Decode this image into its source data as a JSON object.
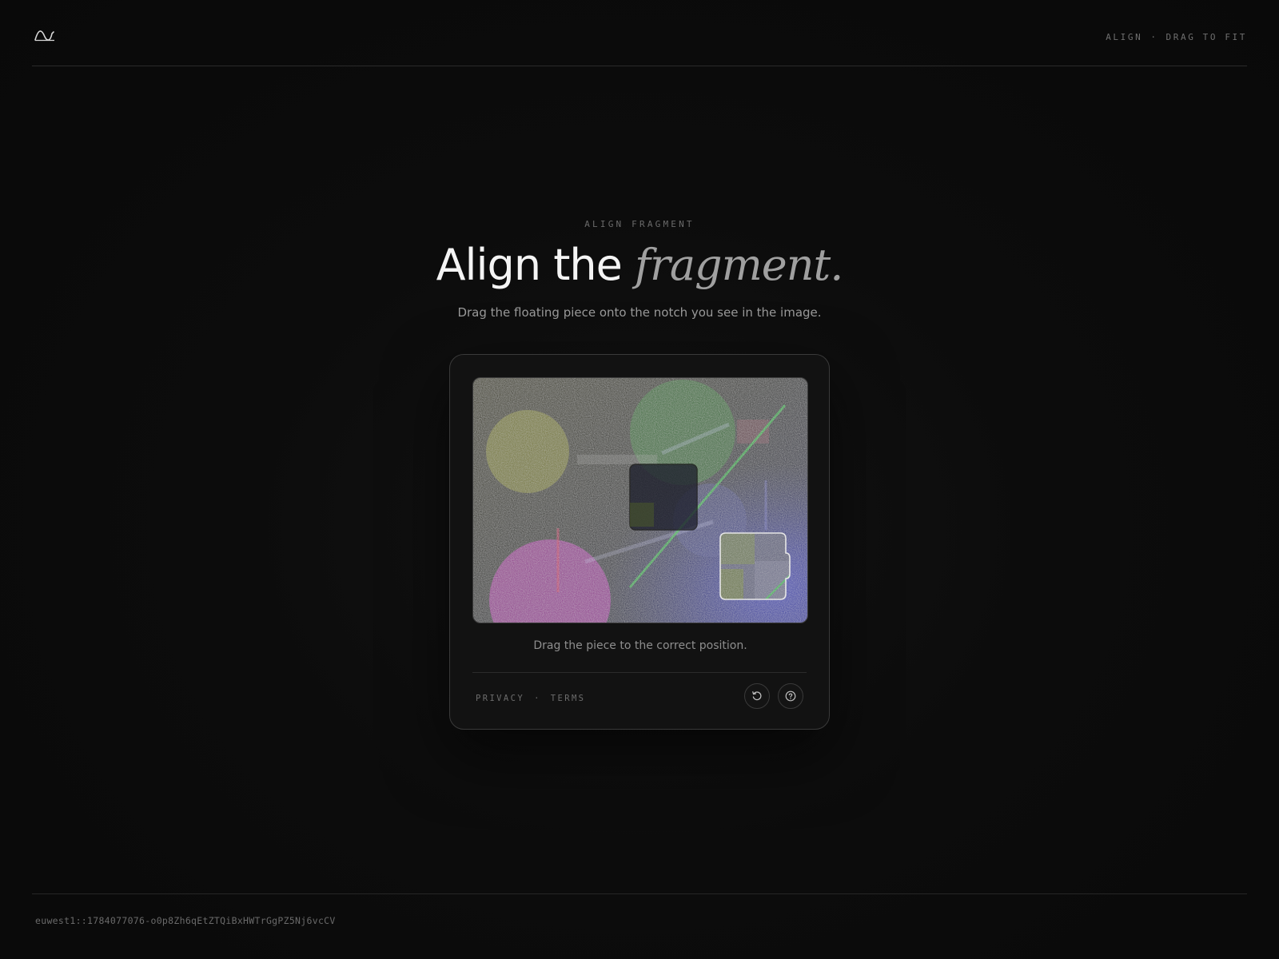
{
  "header": {
    "logo_icon": "wave-logo-icon",
    "status_left": "ALIGN",
    "status_separator": "·",
    "status_right": "DRAG TO FIT"
  },
  "hero": {
    "eyebrow": "ALIGN FRAGMENT",
    "title_main": "Align the",
    "title_accent": "fragment.",
    "subtitle": "Drag the floating piece onto the notch you see in the image."
  },
  "captcha": {
    "instruction": "Drag the piece to the correct position.",
    "footer_links": {
      "privacy": "PRIVACY",
      "separator": "·",
      "terms": "TERMS"
    },
    "buttons": {
      "refresh_icon": "refresh-icon",
      "help_icon": "help-icon"
    }
  },
  "footer": {
    "session_id": "euwest1::1784077076-o0p8Zh6qEtZTQiBxHWTrGgPZ5Nj6vcCV"
  },
  "colors": {
    "background": "#0b0b0b",
    "card_border": "#3a3a3a",
    "text_primary": "#f4f4f4",
    "text_muted": "#9a9a9a"
  }
}
